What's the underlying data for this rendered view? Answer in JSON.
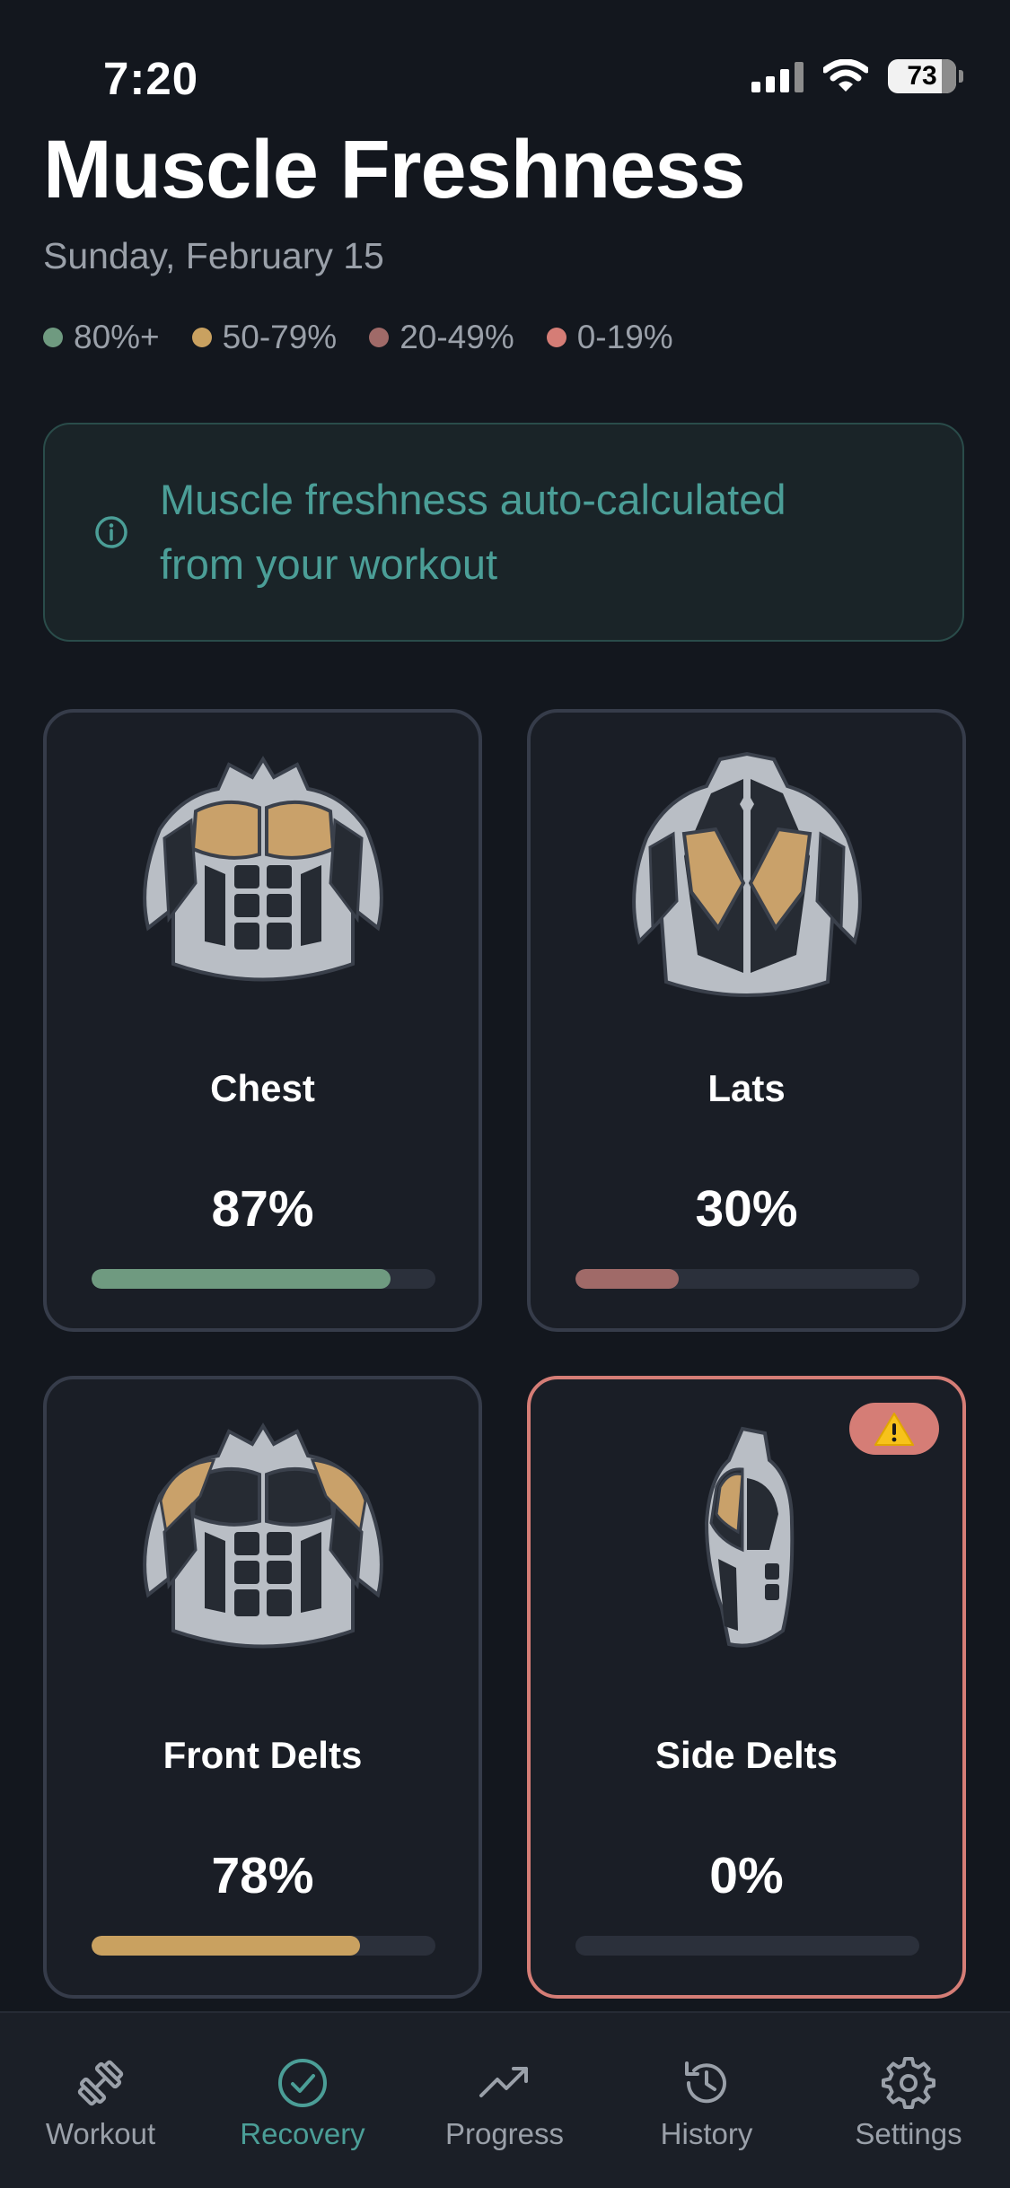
{
  "status_bar": {
    "time": "7:20",
    "battery": "73",
    "signal_icon": "cellular-signal-icon",
    "wifi_icon": "wifi-icon",
    "battery_icon": "battery-icon"
  },
  "header": {
    "title": "Muscle Freshness",
    "date": "Sunday, February 15"
  },
  "legend": [
    {
      "label": "80%+",
      "color": "#6f9a80"
    },
    {
      "label": "50-79%",
      "color": "#c9a160"
    },
    {
      "label": "20-49%",
      "color": "#a06a68"
    },
    {
      "label": "0-19%",
      "color": "#d57d76"
    }
  ],
  "info_banner": {
    "text": "Muscle freshness auto-calculated from your workout",
    "icon": "info-icon"
  },
  "muscles": [
    {
      "name": "Chest",
      "percent": "87%",
      "value": 0.87,
      "color": "#6f9a80",
      "alert": false
    },
    {
      "name": "Lats",
      "percent": "30%",
      "value": 0.3,
      "color": "#a06a68",
      "alert": false
    },
    {
      "name": "Front Delts",
      "percent": "78%",
      "value": 0.78,
      "color": "#c9a160",
      "alert": false
    },
    {
      "name": "Side Delts",
      "percent": "0%",
      "value": 0.0,
      "color": "#d57d76",
      "alert": true,
      "badge_icon": "warning-icon"
    }
  ],
  "tab_bar": {
    "tabs": [
      {
        "label": "Workout",
        "icon": "dumbbell-icon",
        "active": false
      },
      {
        "label": "Recovery",
        "icon": "check-circle-icon",
        "active": true
      },
      {
        "label": "Progress",
        "icon": "trending-up-icon",
        "active": false
      },
      {
        "label": "History",
        "icon": "history-icon",
        "active": false
      },
      {
        "label": "Settings",
        "icon": "gear-icon",
        "active": false
      }
    ]
  },
  "colors": {
    "background": "#13171e",
    "accent": "#4b9e97",
    "card_border": "#363c4a",
    "alert_border": "#d57d76",
    "muscle_highlight": "#c9a16a",
    "body_fill": "#b9bec5"
  }
}
